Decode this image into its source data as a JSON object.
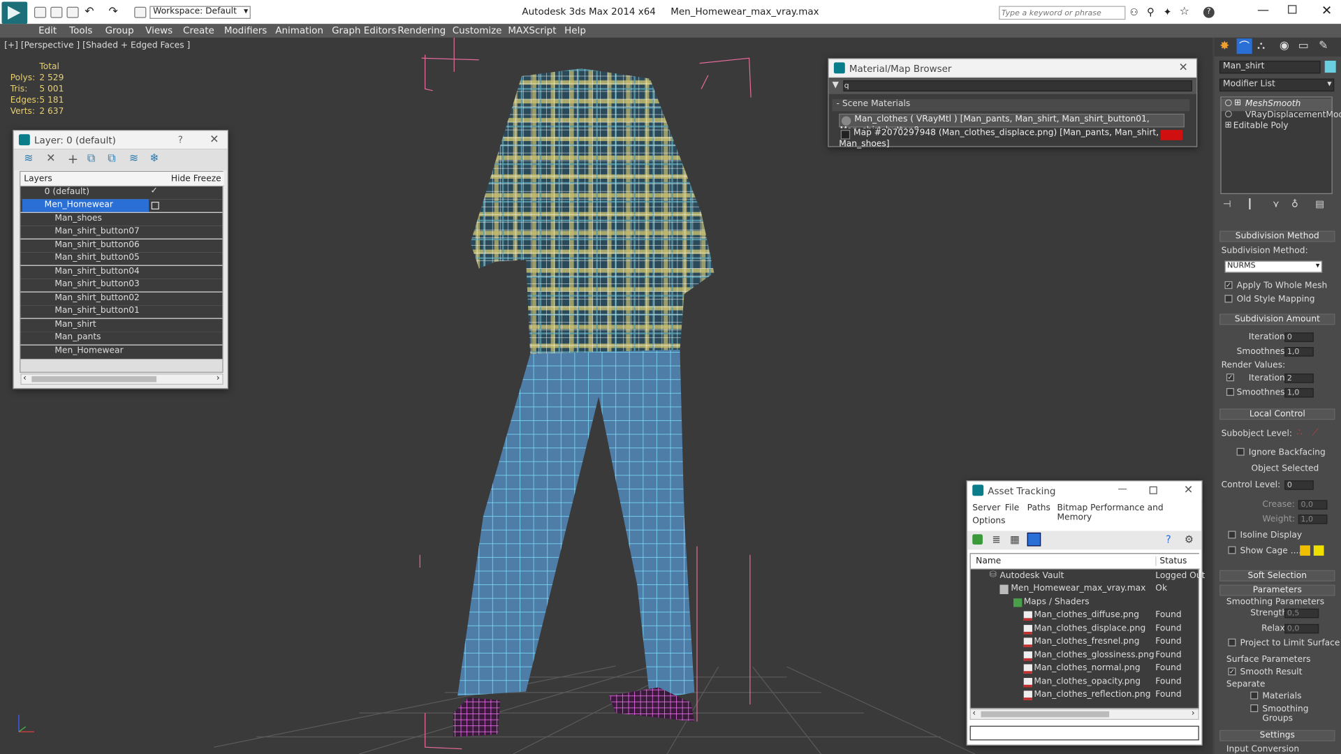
{
  "app": {
    "title": "Autodesk 3ds Max  2014 x64",
    "file": "Men_Homewear_max_vray.max",
    "workspace": "Workspace: Default",
    "search_placeholder": "Type a keyword or phrase"
  },
  "menu": [
    "Edit",
    "Tools",
    "Group",
    "Views",
    "Create",
    "Modifiers",
    "Animation",
    "Graph Editors",
    "Rendering",
    "Customize",
    "MAXScript",
    "Help"
  ],
  "viewport": {
    "label": "[+] [Perspective ] [Shaded + Edged Faces ]",
    "stats": {
      "total": "Total",
      "polys_label": "Polys:",
      "polys": "2 529",
      "tris_label": "Tris:",
      "tris": "5 001",
      "edges_label": "Edges:",
      "edges": "5 181",
      "verts_label": "Verts:",
      "verts": "2 637"
    }
  },
  "layer_panel": {
    "title": "Layer: 0 (default)",
    "help": "?",
    "cols": {
      "layers": "Layers",
      "hide": "Hide",
      "freeze": "Freeze"
    },
    "rows": [
      "0 (default)",
      "Men_Homewear",
      "Man_shoes",
      "Man_shirt_button07",
      "Man_shirt_button06",
      "Man_shirt_button05",
      "Man_shirt_button04",
      "Man_shirt_button03",
      "Man_shirt_button02",
      "Man_shirt_button01",
      "Man_shirt",
      "Man_pants",
      "Men_Homewear"
    ]
  },
  "mat_browser": {
    "title": "Material/Map Browser",
    "search": "q",
    "section": "Scene Materials",
    "items": [
      "Man_clothes  ( VRayMtl ) [Man_pants, Man_shirt, Man_shirt_button01, Man_shirt_button0...",
      "Map #2070297948 (Man_clothes_displace.png)  [Man_pants, Man_shirt, Man_shoes]"
    ]
  },
  "asset": {
    "title": "Asset Tracking",
    "menu": [
      "Server",
      "File",
      "Paths",
      "Bitmap Performance and Memory",
      "Options"
    ],
    "col_name": "Name",
    "col_status": "Status",
    "rows": [
      {
        "name": "Autodesk Vault",
        "status": "Logged Out"
      },
      {
        "name": "Men_Homewear_max_vray.max",
        "status": "Ok"
      },
      {
        "name": "Maps / Shaders",
        "status": ""
      },
      {
        "name": "Man_clothes_diffuse.png",
        "status": "Found"
      },
      {
        "name": "Man_clothes_displace.png",
        "status": "Found"
      },
      {
        "name": "Man_clothes_fresnel.png",
        "status": "Found"
      },
      {
        "name": "Man_clothes_glossiness.png",
        "status": "Found"
      },
      {
        "name": "Man_clothes_normal.png",
        "status": "Found"
      },
      {
        "name": "Man_clothes_opacity.png",
        "status": "Found"
      },
      {
        "name": "Man_clothes_reflection.png",
        "status": "Found"
      }
    ]
  },
  "cmd": {
    "object": "Man_shirt",
    "modifier_list": "Modifier List",
    "stack": [
      "MeshSmooth",
      "VRayDisplacementMod",
      "Editable Poly"
    ],
    "subdiv_method_title": "Subdivision Method",
    "subdiv_method_label": "Subdivision Method:",
    "subdiv_method": "NURMS",
    "apply_whole": "Apply To Whole Mesh",
    "old_style": "Old Style Mapping",
    "subdiv_amount": "Subdivision Amount",
    "iterations": "Iterations:",
    "iterations_val": "0",
    "smoothness": "Smoothness:",
    "smoothness_val": "1,0",
    "render_values": "Render Values:",
    "r_iterations_val": "2",
    "r_smoothness_val": "1,0",
    "local_control": "Local Control",
    "subobject": "Subobject Level:",
    "ignore_backfacing": "Ignore Backfacing",
    "object_selected": "Object Selected",
    "control_level": "Control Level:",
    "control_level_val": "0",
    "crease": "Crease:",
    "crease_val": "0,0",
    "weight": "Weight:",
    "weight_val": "1,0",
    "isoline": "Isoline Display",
    "show_cage": "Show Cage ......",
    "soft_selection": "Soft Selection",
    "parameters": "Parameters",
    "smoothing_params": "Smoothing Parameters",
    "strength": "Strength:",
    "strength_val": "0,5",
    "relax": "Relax:",
    "relax_val": "0,0",
    "project": "Project to Limit Surface",
    "surface_params": "Surface Parameters",
    "smooth_result": "Smooth Result",
    "separate": "Separate",
    "materials": "Materials",
    "smoothing_groups": "Smoothing Groups",
    "settings": "Settings",
    "input_conversion": "Input Conversion"
  }
}
